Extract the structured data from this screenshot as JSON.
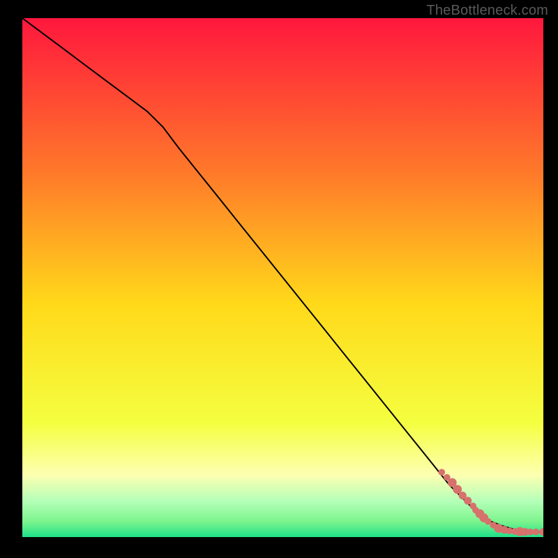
{
  "watermark": "TheBottleneck.com",
  "colors": {
    "background": "#000000",
    "line": "#000000",
    "marker": "#d6716c",
    "grad_top": "#ff173d",
    "grad_mid_upper": "#ff7a2a",
    "grad_mid": "#ffd91a",
    "grad_mid_lower": "#f4ff40",
    "grad_green_top": "#7cf48d",
    "grad_green": "#1ee08a"
  },
  "chart_data": {
    "type": "line",
    "title": "",
    "xlabel": "",
    "ylabel": "",
    "xlim": [
      0,
      100
    ],
    "ylim": [
      0,
      100
    ],
    "series": [
      {
        "name": "curve",
        "x": [
          0,
          4,
          8,
          12,
          16,
          20,
          24,
          27,
          30,
          34,
          38,
          42,
          46,
          50,
          54,
          58,
          62,
          66,
          70,
          74,
          78,
          82,
          85,
          88,
          90,
          92,
          94,
          96,
          98,
          100
        ],
        "y": [
          100,
          97,
          94,
          91,
          88,
          85,
          82,
          79,
          75,
          70,
          65,
          60,
          55,
          50,
          45,
          40,
          35,
          30,
          25,
          20,
          15,
          10,
          7,
          4,
          3,
          2.2,
          1.6,
          1.2,
          1.0,
          1.0
        ]
      }
    ],
    "markers": [
      {
        "x": 80.5,
        "y": 12.5,
        "r": 1.2
      },
      {
        "x": 81.5,
        "y": 11.5,
        "r": 1.2
      },
      {
        "x": 82.5,
        "y": 10.5,
        "r": 1.6
      },
      {
        "x": 83.5,
        "y": 9.2,
        "r": 1.6
      },
      {
        "x": 84.5,
        "y": 8.0,
        "r": 1.4
      },
      {
        "x": 85.5,
        "y": 7.0,
        "r": 1.4
      },
      {
        "x": 86.5,
        "y": 6.0,
        "r": 1.2
      },
      {
        "x": 87.0,
        "y": 5.2,
        "r": 1.2
      },
      {
        "x": 87.8,
        "y": 4.5,
        "r": 1.6
      },
      {
        "x": 88.6,
        "y": 3.7,
        "r": 1.6
      },
      {
        "x": 89.4,
        "y": 3.0,
        "r": 1.2
      },
      {
        "x": 90.4,
        "y": 2.3,
        "r": 1.2
      },
      {
        "x": 91.4,
        "y": 1.7,
        "r": 1.6
      },
      {
        "x": 92.5,
        "y": 1.4,
        "r": 1.4
      },
      {
        "x": 93.5,
        "y": 1.2,
        "r": 1.2
      },
      {
        "x": 94.5,
        "y": 1.1,
        "r": 1.2
      },
      {
        "x": 95.5,
        "y": 1.05,
        "r": 1.6
      },
      {
        "x": 96.5,
        "y": 1.0,
        "r": 1.4
      },
      {
        "x": 97.5,
        "y": 1.0,
        "r": 1.2
      },
      {
        "x": 98.6,
        "y": 1.0,
        "r": 1.2
      },
      {
        "x": 100.0,
        "y": 1.0,
        "r": 1.4
      }
    ]
  }
}
